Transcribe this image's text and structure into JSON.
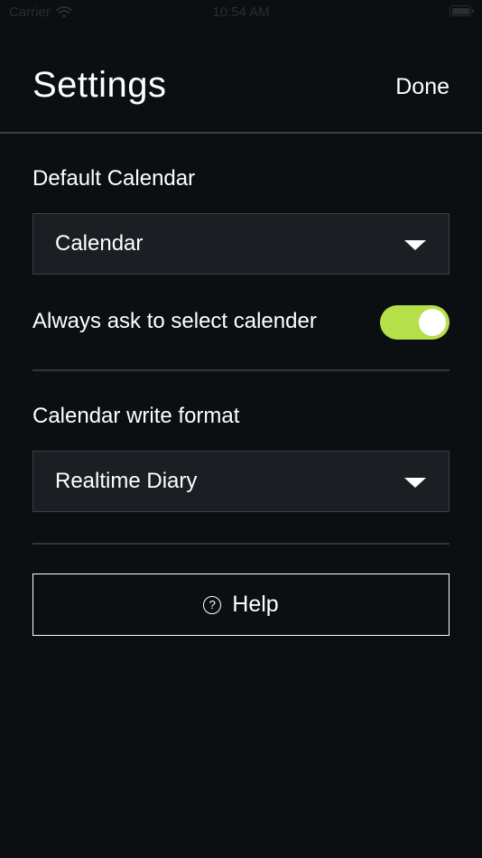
{
  "status_bar": {
    "carrier": "Carrier",
    "time": "10:54 AM",
    "wifi_icon": "wifi-icon",
    "battery_icon": "battery-icon"
  },
  "header": {
    "title": "Settings",
    "done_label": "Done"
  },
  "default_calendar": {
    "label": "Default Calendar",
    "selected": "Calendar",
    "caret_icon": "caret-down-icon"
  },
  "always_ask": {
    "label": "Always ask to select calender",
    "enabled": true,
    "accent_color": "#b6e04a"
  },
  "write_format": {
    "label": "Calendar write format",
    "selected": "Realtime Diary",
    "caret_icon": "caret-down-icon"
  },
  "help": {
    "label": "Help",
    "icon": "question-circle-icon",
    "icon_glyph": "?"
  },
  "colors": {
    "background": "#0c0f12",
    "field_background": "#1b1e22",
    "accent": "#b6e04a"
  }
}
